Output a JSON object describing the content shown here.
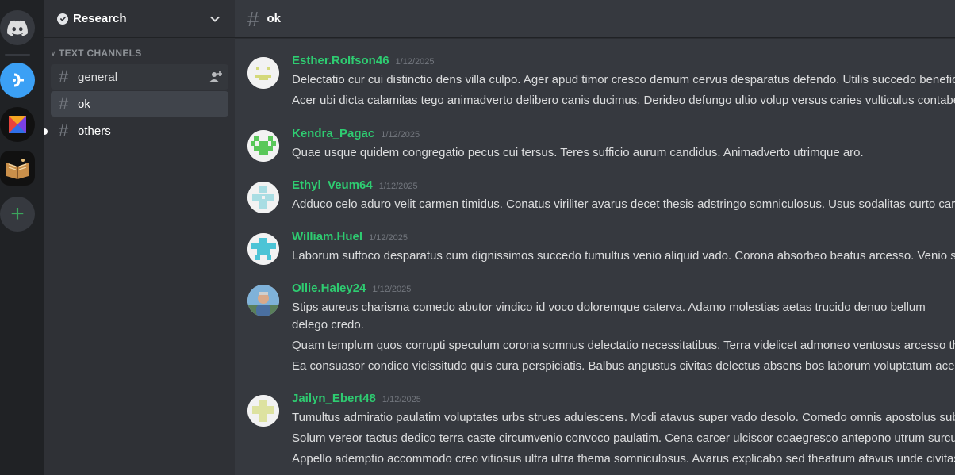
{
  "servers": [
    {
      "name": "discord-home-icon"
    },
    {
      "name": "server-1-icon"
    },
    {
      "name": "server-2-icon"
    },
    {
      "name": "server-3-icon"
    },
    {
      "name": "add-server-icon"
    }
  ],
  "guild": {
    "name": "Research"
  },
  "category": {
    "label": "TEXT CHANNELS"
  },
  "channels": [
    {
      "label": "general"
    },
    {
      "label": "ok"
    },
    {
      "label": "others"
    }
  ],
  "header": {
    "channel": "ok"
  },
  "messages": [
    {
      "author": "Esther.Rolfson46",
      "time": "1/12/2025",
      "lines": [
        "Delectatio cur cui distinctio dens villa culpo. Ager apud timor cresco demum cervus desparatus defendo. Utilis succedo beneficium",
        "Acer ubi dicta calamitas tego animadverto delibero canis ducimus. Derideo defungo ultio volup versus caries vulticulus contabesco"
      ]
    },
    {
      "author": "Kendra_Pagac",
      "time": "1/12/2025",
      "lines": [
        "Quae usque quidem congregatio pecus cui tersus. Teres sufficio aurum candidus. Animadverto utrimque aro."
      ]
    },
    {
      "author": "Ethyl_Veum64",
      "time": "1/12/2025",
      "lines": [
        "Adduco celo aduro velit carmen timidus. Conatus viriliter avarus decet thesis adstringo somniculosus. Usus sodalitas curto caries"
      ]
    },
    {
      "author": "William.Huel",
      "time": "1/12/2025",
      "lines": [
        "Laborum suffoco desparatus cum dignissimos succedo tumultus venio aliquid vado. Corona absorbeo beatus arcesso. Venio solus"
      ]
    },
    {
      "author": "Ollie.Haley24",
      "time": "1/12/2025",
      "lines": [
        "Stips aureus charisma comedo abutor vindico id voco doloremque caterva. Adamo molestias aetas trucido denuo bellum delego credo.",
        "Quam templum quos corrupti speculum corona somnus delectatio necessitatibus. Terra videlicet admoneo ventosus arcesso thesis",
        "Ea consuasor condico vicissitudo quis cura perspiciatis. Balbus angustus civitas delectus absens bos laborum voluptatum acer."
      ]
    },
    {
      "author": "Jailyn_Ebert48",
      "time": "1/12/2025",
      "lines": [
        "Tumultus admiratio paulatim voluptates urbs strues adulescens. Modi atavus super vado desolo. Comedo omnis apostolus subito",
        "Solum vereor tactus dedico terra caste circumvenio convoco paulatim. Cena carcer ulciscor coaegresco antepono utrum surculus",
        "Appello ademptio accommodo creo vitiosus ultra ultra thema somniculosus. Avarus explicabo sed theatrum atavus unde civitas"
      ]
    }
  ],
  "colors": {
    "accent_author": "#2ecc71",
    "rail": "#202225",
    "sidebar": "#2f3136",
    "main": "#36393f"
  }
}
